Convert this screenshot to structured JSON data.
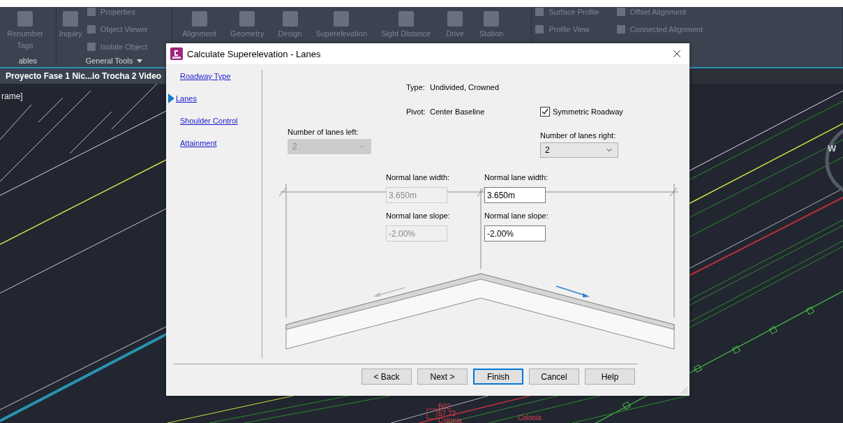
{
  "ribbon": {
    "panels": [
      {
        "large": [
          "Renumber Tags"
        ],
        "footer": "ables"
      },
      {
        "large": [
          "Inquiry"
        ],
        "small": [
          "Properties",
          "Object Viewer",
          "Isolate Object"
        ],
        "footer": "General Tools",
        "footer_menu": true
      },
      {
        "large": [
          "Alignment",
          "Geometry",
          "Design",
          "Superelevation",
          "Sight Distance",
          "Drive",
          "Station"
        ]
      },
      {
        "small": [
          "Surface Profile",
          "Offset Alignment",
          "Profile View",
          "Connected Alignment"
        ]
      }
    ]
  },
  "document_tab": "Proyecto Fase 1 Nic...io Trocha 2 Video",
  "canvas": {
    "view_label": "rame]",
    "compass_letter": "W",
    "point_labels": [
      [
        "B02",
        "57.72",
        "Colonia"
      ],
      [
        "Colonia"
      ]
    ]
  },
  "dialog": {
    "title": "Calculate Superelevation - Lanes",
    "nav": [
      {
        "label": "Roadway Type",
        "selected": false
      },
      {
        "label": "Lanes",
        "selected": true
      },
      {
        "label": "Shoulder Control",
        "selected": false
      },
      {
        "label": "Attainment",
        "selected": false
      }
    ],
    "type_label": "Type:",
    "type_value": "Undivided, Crowned",
    "pivot_label": "Pivot:",
    "pivot_value": "Center Baseline",
    "symmetric": {
      "label": "Symmetric Roadway",
      "checked": true
    },
    "lanes_left": {
      "label": "Number of lanes left:",
      "value": "2",
      "disabled": true
    },
    "lanes_right": {
      "label": "Number of lanes right:",
      "value": "2",
      "disabled": false
    },
    "left_fields": [
      {
        "label": "Normal lane width:",
        "value": "3.650m",
        "disabled": true
      },
      {
        "label": "Normal lane slope:",
        "value": "-2.00%",
        "disabled": true
      }
    ],
    "right_fields": [
      {
        "label": "Normal lane width:",
        "value": "3.650m",
        "disabled": false
      },
      {
        "label": "Normal lane slope:",
        "value": "-2.00%",
        "disabled": false
      }
    ],
    "buttons": [
      {
        "label": "< Back",
        "focused": false
      },
      {
        "label": "Next >",
        "focused": false
      },
      {
        "label": "Finish",
        "focused": true
      },
      {
        "label": "Cancel",
        "focused": false
      },
      {
        "label": "Help",
        "focused": false
      }
    ]
  }
}
